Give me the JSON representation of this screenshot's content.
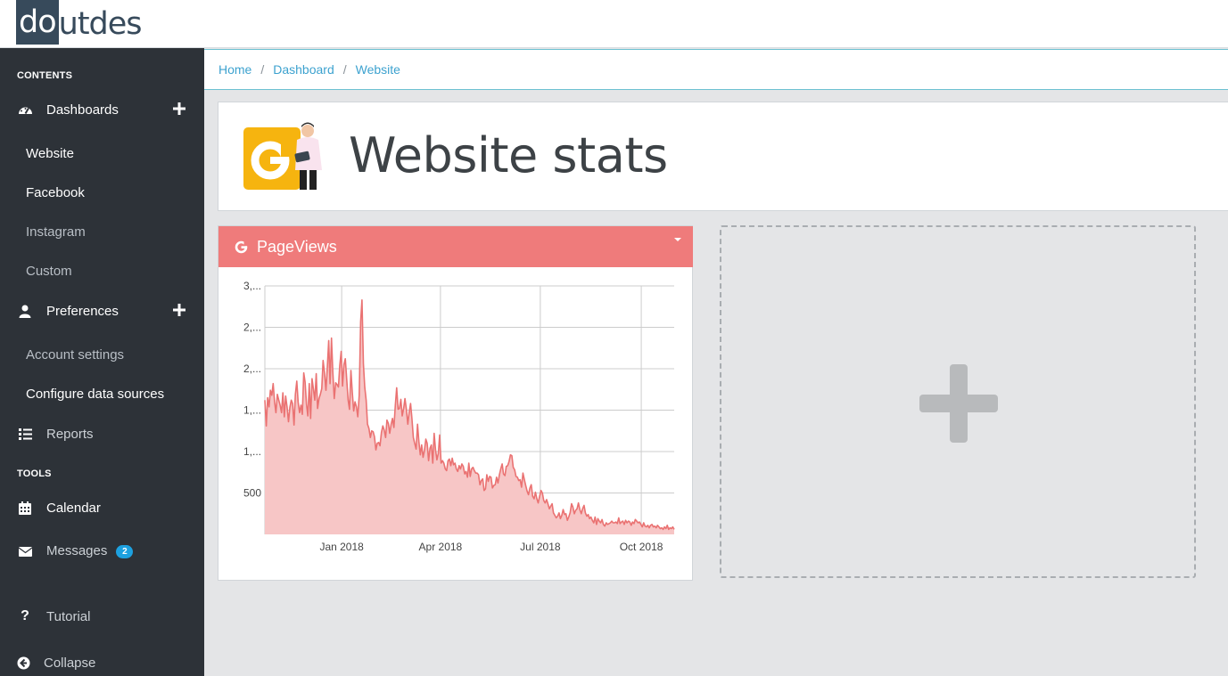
{
  "logo": {
    "part1": "do",
    "part2": "ut",
    "part3": "des"
  },
  "sidebar": {
    "contents_label": "CONTENTS",
    "dashboards": {
      "label": "Dashboards",
      "icon": "dashboard-icon"
    },
    "dashboard_items": [
      "Website",
      "Facebook",
      "Instagram",
      "Custom"
    ],
    "preferences": {
      "label": "Preferences",
      "icon": "user-icon"
    },
    "preference_items": [
      "Account settings",
      "Configure data sources"
    ],
    "reports": {
      "label": "Reports",
      "icon": "list-icon"
    },
    "tools_label": "TOOLS",
    "calendar": {
      "label": "Calendar",
      "icon": "calendar-icon"
    },
    "messages": {
      "label": "Messages",
      "badge": "2",
      "icon": "envelope-icon"
    },
    "tutorial": {
      "label": "Tutorial",
      "icon": "question-icon"
    },
    "collapse": {
      "label": "Collapse",
      "icon": "arrow-left-circle-icon"
    }
  },
  "breadcrumb": [
    "Home",
    "Dashboard",
    "Website"
  ],
  "page": {
    "title": "Website stats"
  },
  "widget": {
    "title": "PageViews",
    "header_color": "#ef7b7b"
  },
  "colors": {
    "accent": "#1da1e0",
    "sidebar": "#2d3238",
    "line": "#ea7272",
    "area": "#f7c6c6"
  },
  "chart_data": {
    "type": "area",
    "title": "PageViews",
    "x_ticks": [
      "Jan 2018",
      "Apr 2018",
      "Jul 2018",
      "Oct 2018"
    ],
    "y_ticks": [
      "500",
      "1,...",
      "1,...",
      "2,...",
      "2,...",
      "3,..."
    ],
    "ylim": [
      0,
      3000
    ],
    "grid": true,
    "x_start": "2017-10-23",
    "x_end": "2018-10-31",
    "series": [
      {
        "values": [
          1620,
          1310,
          1650,
          1540,
          1740,
          1680,
          1820,
          1600,
          1470,
          1690,
          1620,
          1560,
          1470,
          1710,
          1420,
          1670,
          1540,
          1360,
          1530,
          1620,
          1580,
          1320,
          1690,
          1850,
          1600,
          1470,
          1560,
          1450,
          1950,
          1840,
          1570,
          1430,
          1820,
          1400,
          1880,
          1750,
          1620,
          1940,
          1520,
          1640,
          1690,
          1760,
          2100,
          1950,
          1740,
          2010,
          2340,
          1820,
          2370,
          1960,
          1640,
          1830,
          1810,
          1780,
          2040,
          2210,
          1790,
          2050,
          2120,
          1870,
          1620,
          1510,
          1980,
          1720,
          1490,
          1600,
          1540,
          1420,
          1680,
          2570,
          2830,
          2060,
          1780,
          1620,
          1330,
          1280,
          1170,
          1250,
          1240,
          1180,
          1020,
          1100,
          1110,
          1070,
          1230,
          1310,
          1260,
          1170,
          1380,
          1340,
          1220,
          1330,
          1400,
          1290,
          1560,
          1770,
          1510,
          1520,
          1630,
          1430,
          1520,
          1640,
          1510,
          1330,
          1470,
          1580,
          1400,
          1170,
          1100,
          1030,
          1330,
          1120,
          960,
          1080,
          930,
          1010,
          1150,
          1100,
          890,
          1040,
          1080,
          860,
          1220,
          1020,
          900,
          980,
          1200,
          860,
          890,
          860,
          790,
          770,
          890,
          910,
          830,
          920,
          840,
          860,
          790,
          760,
          830,
          790,
          850,
          820,
          730,
          760,
          690,
          860,
          700,
          790,
          810,
          770,
          740,
          740,
          720,
          600,
          650,
          670,
          530,
          550,
          720,
          640,
          700,
          690,
          560,
          590,
          600,
          690,
          620,
          720,
          790,
          850,
          730,
          710,
          820,
          830,
          880,
          960,
          950,
          810,
          780,
          700,
          690,
          650,
          660,
          570,
          740,
          660,
          590,
          520,
          480,
          560,
          600,
          460,
          430,
          510,
          430,
          380,
          460,
          530,
          500,
          410,
          380,
          420,
          370,
          310,
          340,
          370,
          260,
          230,
          200,
          220,
          260,
          190,
          230,
          300,
          240,
          250,
          170,
          210,
          260,
          370,
          330,
          250,
          290,
          310,
          380,
          300,
          250,
          310,
          350,
          260,
          220,
          240,
          190,
          210,
          170,
          140,
          210,
          120,
          190,
          160,
          140,
          180,
          120,
          100,
          140,
          120,
          130,
          140,
          160,
          140,
          140,
          150,
          130,
          200,
          130,
          150,
          160,
          120,
          170,
          140,
          160,
          150,
          110,
          150,
          130,
          180,
          160,
          140,
          150,
          120,
          90,
          140,
          100,
          90,
          110,
          80,
          110,
          120,
          90,
          100,
          80,
          110,
          90,
          70,
          80,
          60,
          90,
          70,
          110,
          60,
          80,
          70,
          90,
          60
        ]
      }
    ]
  }
}
